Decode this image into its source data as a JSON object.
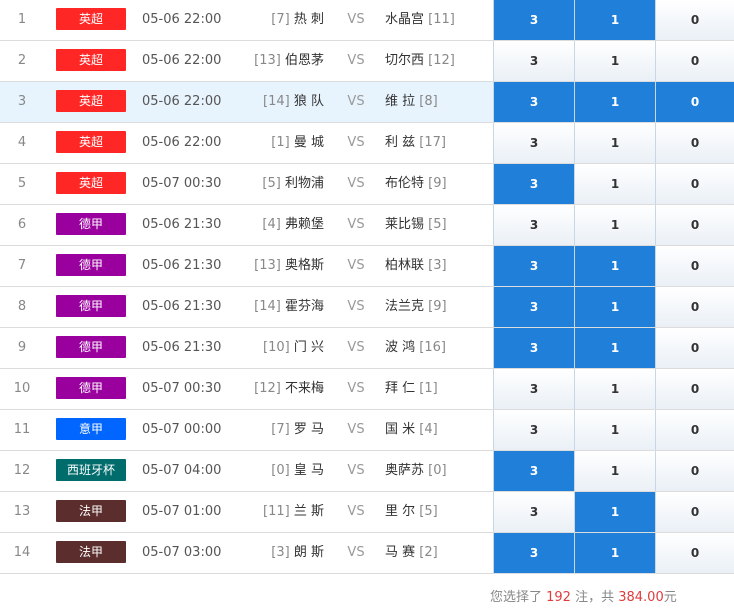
{
  "colors": {
    "英超": "#ff2626",
    "德甲": "#99009e",
    "意甲": "#0066ff",
    "西班牙杯": "#006c6c",
    "法甲": "#5b2d2d",
    "selected": "#1f7fd9"
  },
  "matches": [
    {
      "num": "1",
      "league": "英超",
      "time": "05-06 22:00",
      "home_rank": "[7]",
      "home": "热 刺",
      "vs": "VS",
      "away": "水晶宫",
      "away_rank": "[11]",
      "o3": "3",
      "o1": "1",
      "o0": "0",
      "sel": [
        true,
        true,
        false
      ],
      "highlight": false
    },
    {
      "num": "2",
      "league": "英超",
      "time": "05-06 22:00",
      "home_rank": "[13]",
      "home": "伯恩茅",
      "vs": "VS",
      "away": "切尔西",
      "away_rank": "[12]",
      "o3": "3",
      "o1": "1",
      "o0": "0",
      "sel": [
        false,
        false,
        false
      ],
      "highlight": false
    },
    {
      "num": "3",
      "league": "英超",
      "time": "05-06 22:00",
      "home_rank": "[14]",
      "home": "狼 队",
      "vs": "VS",
      "away": "维 拉",
      "away_rank": "[8]",
      "o3": "3",
      "o1": "1",
      "o0": "0",
      "sel": [
        true,
        true,
        true
      ],
      "highlight": true
    },
    {
      "num": "4",
      "league": "英超",
      "time": "05-06 22:00",
      "home_rank": "[1]",
      "home": "曼 城",
      "vs": "VS",
      "away": "利 兹",
      "away_rank": "[17]",
      "o3": "3",
      "o1": "1",
      "o0": "0",
      "sel": [
        false,
        false,
        false
      ],
      "highlight": false
    },
    {
      "num": "5",
      "league": "英超",
      "time": "05-07 00:30",
      "home_rank": "[5]",
      "home": "利物浦",
      "vs": "VS",
      "away": "布伦特",
      "away_rank": "[9]",
      "o3": "3",
      "o1": "1",
      "o0": "0",
      "sel": [
        true,
        false,
        false
      ],
      "highlight": false
    },
    {
      "num": "6",
      "league": "德甲",
      "time": "05-06 21:30",
      "home_rank": "[4]",
      "home": "弗赖堡",
      "vs": "VS",
      "away": "莱比锡",
      "away_rank": "[5]",
      "o3": "3",
      "o1": "1",
      "o0": "0",
      "sel": [
        false,
        false,
        false
      ],
      "highlight": false
    },
    {
      "num": "7",
      "league": "德甲",
      "time": "05-06 21:30",
      "home_rank": "[13]",
      "home": "奥格斯",
      "vs": "VS",
      "away": "柏林联",
      "away_rank": "[3]",
      "o3": "3",
      "o1": "1",
      "o0": "0",
      "sel": [
        true,
        true,
        false
      ],
      "highlight": false
    },
    {
      "num": "8",
      "league": "德甲",
      "time": "05-06 21:30",
      "home_rank": "[14]",
      "home": "霍芬海",
      "vs": "VS",
      "away": "法兰克",
      "away_rank": "[9]",
      "o3": "3",
      "o1": "1",
      "o0": "0",
      "sel": [
        true,
        true,
        false
      ],
      "highlight": false
    },
    {
      "num": "9",
      "league": "德甲",
      "time": "05-06 21:30",
      "home_rank": "[10]",
      "home": "门 兴",
      "vs": "VS",
      "away": "波 鸿",
      "away_rank": "[16]",
      "o3": "3",
      "o1": "1",
      "o0": "0",
      "sel": [
        true,
        true,
        false
      ],
      "highlight": false
    },
    {
      "num": "10",
      "league": "德甲",
      "time": "05-07 00:30",
      "home_rank": "[12]",
      "home": "不来梅",
      "vs": "VS",
      "away": "拜 仁",
      "away_rank": "[1]",
      "o3": "3",
      "o1": "1",
      "o0": "0",
      "sel": [
        false,
        false,
        false
      ],
      "highlight": false
    },
    {
      "num": "11",
      "league": "意甲",
      "time": "05-07 00:00",
      "home_rank": "[7]",
      "home": "罗 马",
      "vs": "VS",
      "away": "国 米",
      "away_rank": "[4]",
      "o3": "3",
      "o1": "1",
      "o0": "0",
      "sel": [
        false,
        false,
        false
      ],
      "highlight": false
    },
    {
      "num": "12",
      "league": "西班牙杯",
      "time": "05-07 04:00",
      "home_rank": "[0]",
      "home": "皇 马",
      "vs": "VS",
      "away": "奥萨苏",
      "away_rank": "[0]",
      "o3": "3",
      "o1": "1",
      "o0": "0",
      "sel": [
        true,
        false,
        false
      ],
      "highlight": false
    },
    {
      "num": "13",
      "league": "法甲",
      "time": "05-07 01:00",
      "home_rank": "[11]",
      "home": "兰 斯",
      "vs": "VS",
      "away": "里 尔",
      "away_rank": "[5]",
      "o3": "3",
      "o1": "1",
      "o0": "0",
      "sel": [
        false,
        true,
        false
      ],
      "highlight": false
    },
    {
      "num": "14",
      "league": "法甲",
      "time": "05-07 03:00",
      "home_rank": "[3]",
      "home": "朗 斯",
      "vs": "VS",
      "away": "马 赛",
      "away_rank": "[2]",
      "o3": "3",
      "o1": "1",
      "o0": "0",
      "sel": [
        true,
        true,
        false
      ],
      "highlight": false
    }
  ],
  "summary": {
    "prefix": "您选择了 ",
    "count": "192",
    "middle": " 注，共 ",
    "amount": "384.00",
    "suffix": "元"
  }
}
